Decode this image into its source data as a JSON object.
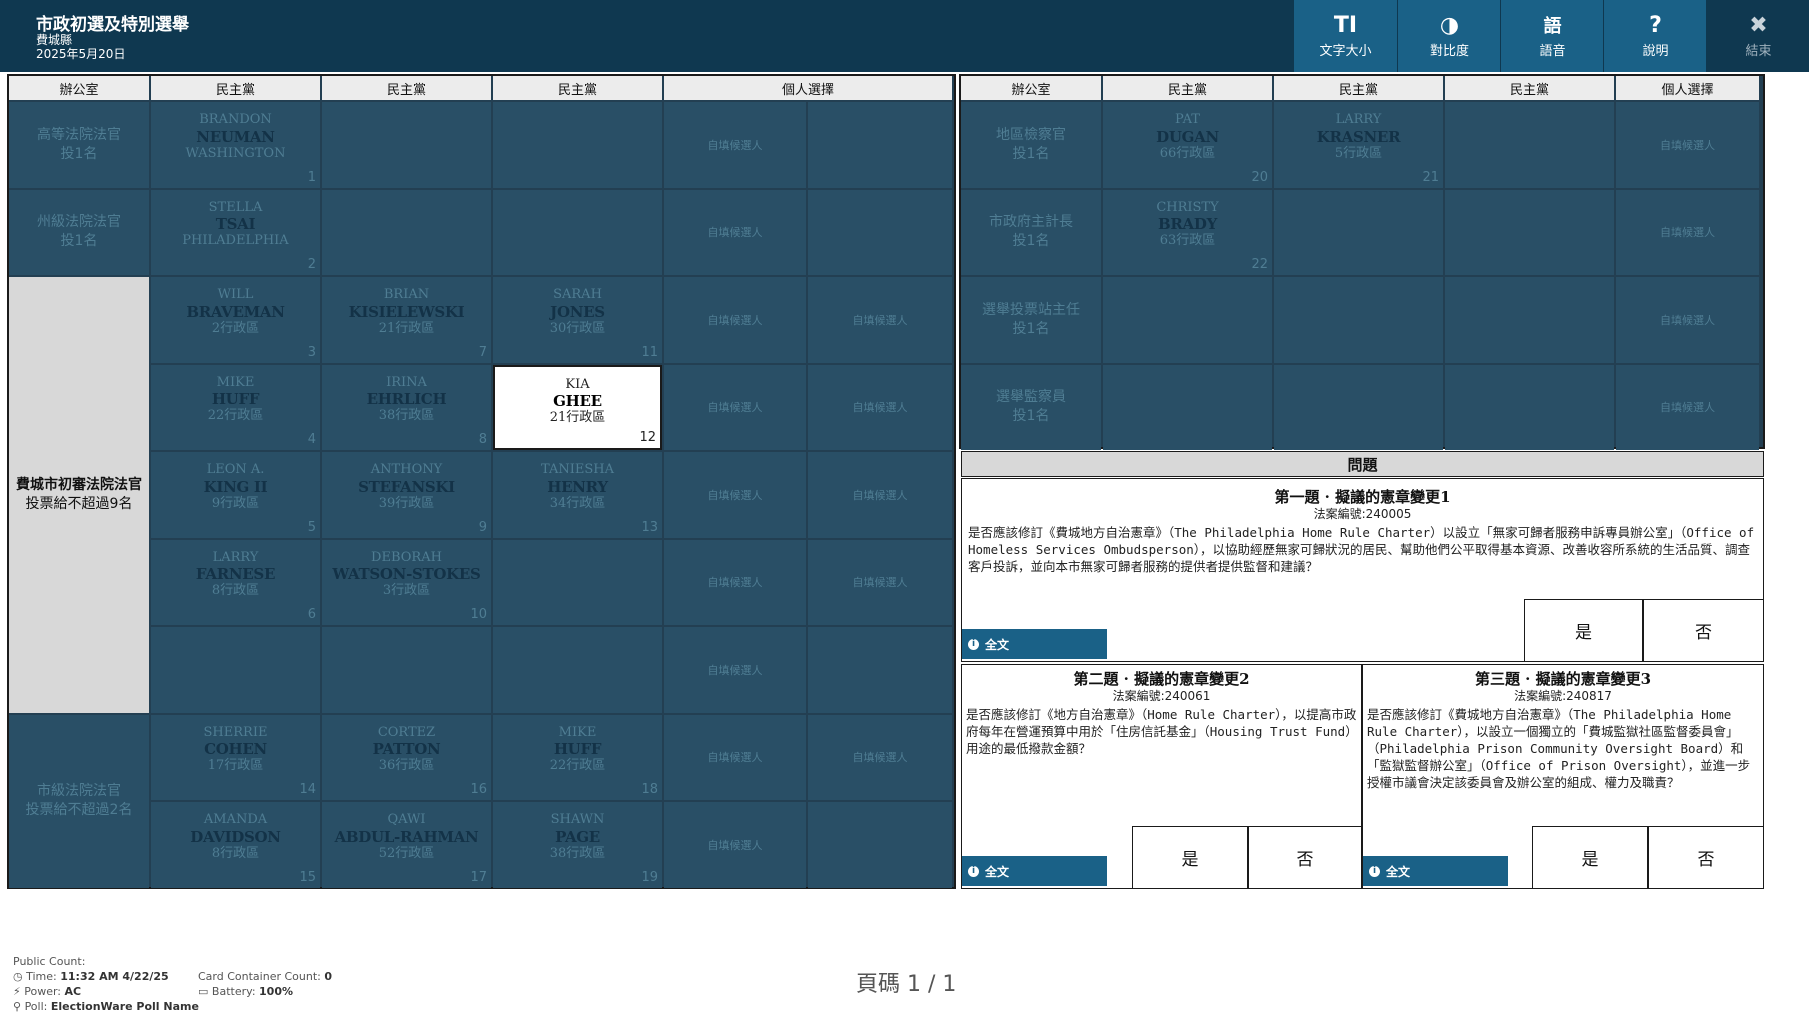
{
  "header": {
    "title": "市政初選及特別選舉",
    "county": "費城縣",
    "date": "2025年5月20日"
  },
  "toolbar": {
    "text_size": {
      "icon": "TI",
      "label": "文字大小"
    },
    "contrast": {
      "icon": "◑",
      "label": "對比度"
    },
    "audio": {
      "icon": "語",
      "label": "語音"
    },
    "help": {
      "icon": "?",
      "label": "說明"
    },
    "exit": {
      "icon": "✖",
      "label": "結束"
    }
  },
  "left_headers": [
    "辦公室",
    "民主黨",
    "民主黨",
    "民主黨",
    "個人選擇"
  ],
  "right_headers": [
    "辦公室",
    "民主黨",
    "民主黨",
    "民主黨",
    "個人選擇"
  ],
  "write_in": "自填候選人",
  "offices": {
    "superior": {
      "name": "高等法院法官",
      "rule": "投1名"
    },
    "commonwealth": {
      "name": "州級法院法官",
      "rule": "投1名"
    },
    "common_pleas": {
      "name": "費城市初審法院法官",
      "rule": "投票給不超過9名"
    },
    "municipal": {
      "name": "市級法院法官",
      "rule": "投票給不超過2名"
    },
    "da": {
      "name": "地區檢察官",
      "rule": "投1名"
    },
    "controller": {
      "name": "市政府主計長",
      "rule": "投1名"
    },
    "judge_elections": {
      "name": "選舉投票站主任",
      "rule": "投1名"
    },
    "inspector": {
      "name": "選舉監察員",
      "rule": "投1名"
    }
  },
  "candidates": {
    "c1": {
      "first": "BRANDON",
      "last": "NEUMAN",
      "district": "WASHINGTON",
      "num": "1"
    },
    "c2": {
      "first": "STELLA",
      "last": "TSAI",
      "district": "PHILADELPHIA",
      "num": "2"
    },
    "c3": {
      "first": "WILL",
      "last": "BRAVEMAN",
      "district": "2行政區",
      "num": "3"
    },
    "c7": {
      "first": "BRIAN",
      "last": "KISIELEWSKI",
      "district": "21行政區",
      "num": "7"
    },
    "c11": {
      "first": "SARAH",
      "last": "JONES",
      "district": "30行政區",
      "num": "11"
    },
    "c4": {
      "first": "MIKE",
      "last": "HUFF",
      "district": "22行政區",
      "num": "4"
    },
    "c8": {
      "first": "IRINA",
      "last": "EHRLICH",
      "district": "38行政區",
      "num": "8"
    },
    "c12": {
      "first": "KIA",
      "last": "GHEE",
      "district": "21行政區",
      "num": "12"
    },
    "c5": {
      "first": "LEON A.",
      "last": "KING II",
      "district": "9行政區",
      "num": "5"
    },
    "c9": {
      "first": "ANTHONY",
      "last": "STEFANSKI",
      "district": "39行政區",
      "num": "9"
    },
    "c13": {
      "first": "TANIESHA",
      "last": "HENRY",
      "district": "34行政區",
      "num": "13"
    },
    "c6": {
      "first": "LARRY",
      "last": "FARNESE",
      "district": "8行政區",
      "num": "6"
    },
    "c10": {
      "first": "DEBORAH",
      "last": "WATSON-STOKES",
      "district": "3行政區",
      "num": "10"
    },
    "c14": {
      "first": "SHERRIE",
      "last": "COHEN",
      "district": "17行政區",
      "num": "14"
    },
    "c16": {
      "first": "CORTEZ",
      "last": "PATTON",
      "district": "36行政區",
      "num": "16"
    },
    "c18": {
      "first": "MIKE",
      "last": "HUFF",
      "district": "22行政區",
      "num": "18"
    },
    "c15": {
      "first": "AMANDA",
      "last": "DAVIDSON",
      "district": "8行政區",
      "num": "15"
    },
    "c17": {
      "first": "QAWI",
      "last": "ABDUL-RAHMAN",
      "district": "52行政區",
      "num": "17"
    },
    "c19": {
      "first": "SHAWN",
      "last": "PAGE",
      "district": "38行政區",
      "num": "19"
    },
    "c20": {
      "first": "PAT",
      "last": "DUGAN",
      "district": "66行政區",
      "num": "20"
    },
    "c21": {
      "first": "LARRY",
      "last": "KRASNER",
      "district": "5行政區",
      "num": "21"
    },
    "c22": {
      "first": "CHRISTY",
      "last": "BRADY",
      "district": "63行政區",
      "num": "22"
    }
  },
  "questions": {
    "heading": "問題",
    "full_text": "全文",
    "yes": "是",
    "no": "否",
    "q1": {
      "title": "第一題 · 擬議的憲章變更1",
      "bill": "法案編號:240005",
      "text": "是否應該修訂《費城地方自治憲章》（The Philadelphia Home Rule Charter）以設立「無家可歸者服務申訴專員辦公室」（Office of Homeless Services Ombudsperson），以協助經歷無家可歸狀況的居民、幫助他們公平取得基本資源、改善收容所系統的生活品質、調查客戶投訴，並向本市無家可歸者服務的提供者提供監督和建議？"
    },
    "q2": {
      "title": "第二題 · 擬議的憲章變更2",
      "bill": "法案編號:240061",
      "text": "是否應該修訂《地方自治憲章》（Home Rule Charter），以提高市政府每年在營運預算中用於「住房信託基金」（Housing Trust Fund）用途的最低撥款金額？"
    },
    "q3": {
      "title": "第三題 · 擬議的憲章變更3",
      "bill": "法案編號:240817",
      "text": "是否應該修訂《費城地方自治憲章》（The Philadelphia Home Rule Charter），以設立一個獨立的「費城監獄社區監督委員會」（Philadelphia Prison Community Oversight Board）和「監獄監督辦公室」（Office of Prison Oversight），並進一步授權市議會決定該委員會及辦公室的組成、權力及職責？"
    }
  },
  "status": {
    "public_count_label": "Public Count:",
    "time_label": "Time:",
    "time_value": "11:32 AM 4/22/25",
    "power_label": "Power:",
    "power_value": "AC",
    "poll_label": "Poll:",
    "poll_value": "ElectionWare Poll Name",
    "card_label": "Card Container Count:",
    "card_value": "0",
    "battery_label": "Battery:",
    "battery_value": "100%"
  },
  "page_indicator": "頁碼 1 / 1"
}
